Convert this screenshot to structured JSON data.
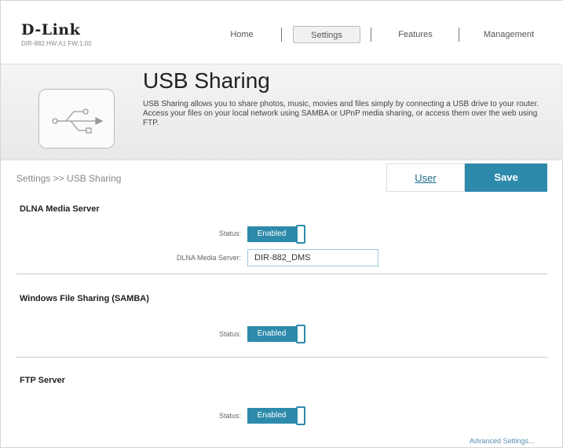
{
  "header": {
    "logo": "D-Link",
    "model": "DIR-882 HW:A1 FW:1.00",
    "nav": [
      {
        "label": "Home"
      },
      {
        "label": "Settings"
      },
      {
        "label": "Features"
      },
      {
        "label": "Management"
      }
    ],
    "active_nav": "Settings"
  },
  "banner": {
    "title": "USB Sharing",
    "description": "USB Sharing allows you to share photos, music, movies and files simply by connecting a USB drive to your router. Access your files on your local network using SAMBA or UPnP media sharing, or access them over the web using FTP.",
    "icon": "usb-icon"
  },
  "breadcrumb": "Settings >> USB Sharing",
  "toolbar": {
    "user_label": "User",
    "save_label": "Save"
  },
  "dlna": {
    "title": "DLNA Media Server",
    "status_label": "Status:",
    "status_value": "Enabled",
    "server_label": "DLNA Media Server:",
    "server_value": "DIR-882_DMS"
  },
  "samba": {
    "title": "Windows File Sharing (SAMBA)",
    "status_label": "Status:",
    "status_value": "Enabled"
  },
  "ftp": {
    "title": "FTP Server",
    "status_label": "Status:",
    "status_value": "Enabled"
  },
  "advanced_link": "Advanced Settings...",
  "colors": {
    "accent": "#2d8aab",
    "link": "#1b6a8e"
  }
}
